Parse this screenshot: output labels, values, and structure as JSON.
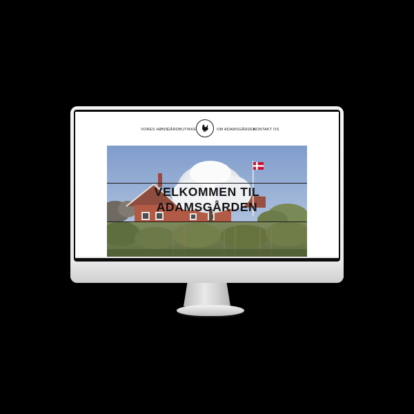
{
  "nav": {
    "items": [
      {
        "label": "VORES HØNS"
      },
      {
        "label": "GÅRDBUTIKKEN"
      },
      {
        "label": "OM ADAMSGÅRDEN"
      },
      {
        "label": "KONTAKT OS"
      }
    ],
    "logo_icon": "hen-icon"
  },
  "hero": {
    "title_line_1": "VELKOMMEN TIL",
    "title_line_2": "ADAMSGÅRDEN",
    "flag_icon": "danish-flag-icon"
  },
  "colors": {
    "page_background": "#000000",
    "site_background": "#ffffff",
    "text": "#141414",
    "sky": "#9ab3d6",
    "roof": "#8e4d3e",
    "brick": "#b15a46",
    "foliage": "#6e7f4e",
    "flag_red": "#c8102e"
  }
}
